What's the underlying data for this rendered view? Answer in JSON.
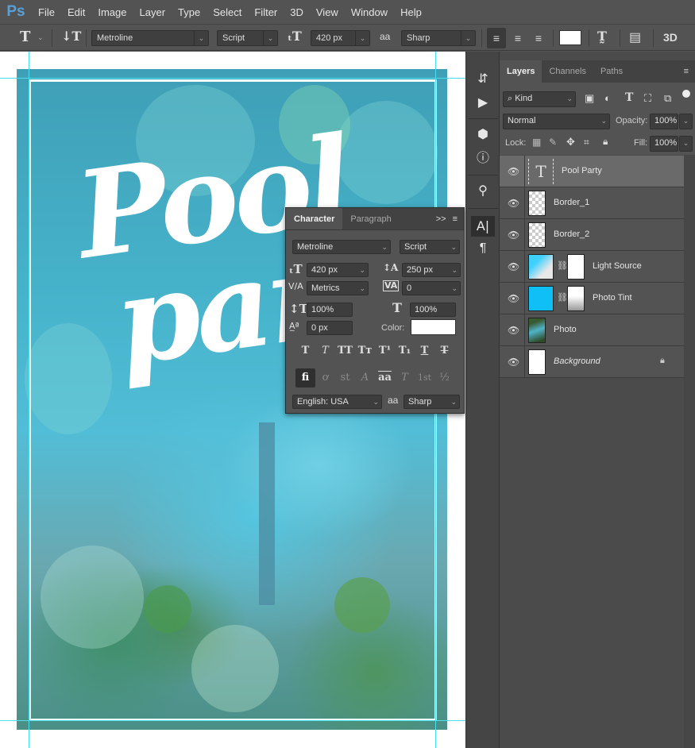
{
  "app": {
    "logo": "Ps"
  },
  "menu": [
    "File",
    "Edit",
    "Image",
    "Layer",
    "Type",
    "Select",
    "Filter",
    "3D",
    "View",
    "Window",
    "Help"
  ],
  "options_bar": {
    "tool_icon": "type-tool-icon",
    "font_family": "Metroline",
    "font_style": "Script",
    "font_size": "420 px",
    "antialias_label": "aa",
    "antialias": "Sharp",
    "align": [
      "left",
      "center",
      "right"
    ],
    "active_align": "left",
    "text_color": "#ffffff",
    "three_d": "3D"
  },
  "canvas": {
    "title_text_line1": "Pool",
    "title_text_line2": "party",
    "accent_guide_color": "#48e0ee"
  },
  "character_panel": {
    "tabs": [
      {
        "label": "Character",
        "active": true
      },
      {
        "label": "Paragraph",
        "active": false
      }
    ],
    "expand_icon": ">>",
    "font_family": "Metroline",
    "font_style": "Script",
    "font_size": "420 px",
    "leading": "250 px",
    "kerning": "Metrics",
    "tracking": "0",
    "vertical_scale": "100%",
    "horizontal_scale": "100%",
    "baseline_shift": "0 px",
    "color_label": "Color:",
    "color_value": "#ffffff",
    "style_buttons": [
      "T",
      "T",
      "TT",
      "Tт",
      "T¹",
      "T₁",
      "T",
      "T"
    ],
    "opentype_buttons": [
      "fi",
      "ơ",
      "st",
      "A",
      "aa",
      "T",
      "1st",
      "½"
    ],
    "language": "English: USA",
    "antialias_label": "aa",
    "antialias": "Sharp"
  },
  "layers_panel": {
    "tabs": [
      {
        "label": "Layers",
        "active": true
      },
      {
        "label": "Channels",
        "active": false
      },
      {
        "label": "Paths",
        "active": false
      }
    ],
    "filter_kind": "Kind",
    "blend_mode": "Normal",
    "opacity_label": "Opacity:",
    "opacity": "100%",
    "lock_label": "Lock:",
    "fill_label": "Fill:",
    "fill": "100%",
    "layers": [
      {
        "name": "Pool Party",
        "type": "text",
        "selected": true,
        "visible": true
      },
      {
        "name": "Border_1",
        "type": "shape",
        "selected": false,
        "visible": true
      },
      {
        "name": "Border_2",
        "type": "shape",
        "selected": false,
        "visible": true
      },
      {
        "name": "Light Source",
        "type": "adjustment-gradient",
        "selected": false,
        "visible": true
      },
      {
        "name": "Photo Tint",
        "type": "adjustment-fill",
        "selected": false,
        "visible": true
      },
      {
        "name": "Photo",
        "type": "smart-object",
        "selected": false,
        "visible": true
      },
      {
        "name": "Background",
        "type": "background",
        "selected": false,
        "visible": true,
        "locked": true
      }
    ]
  }
}
